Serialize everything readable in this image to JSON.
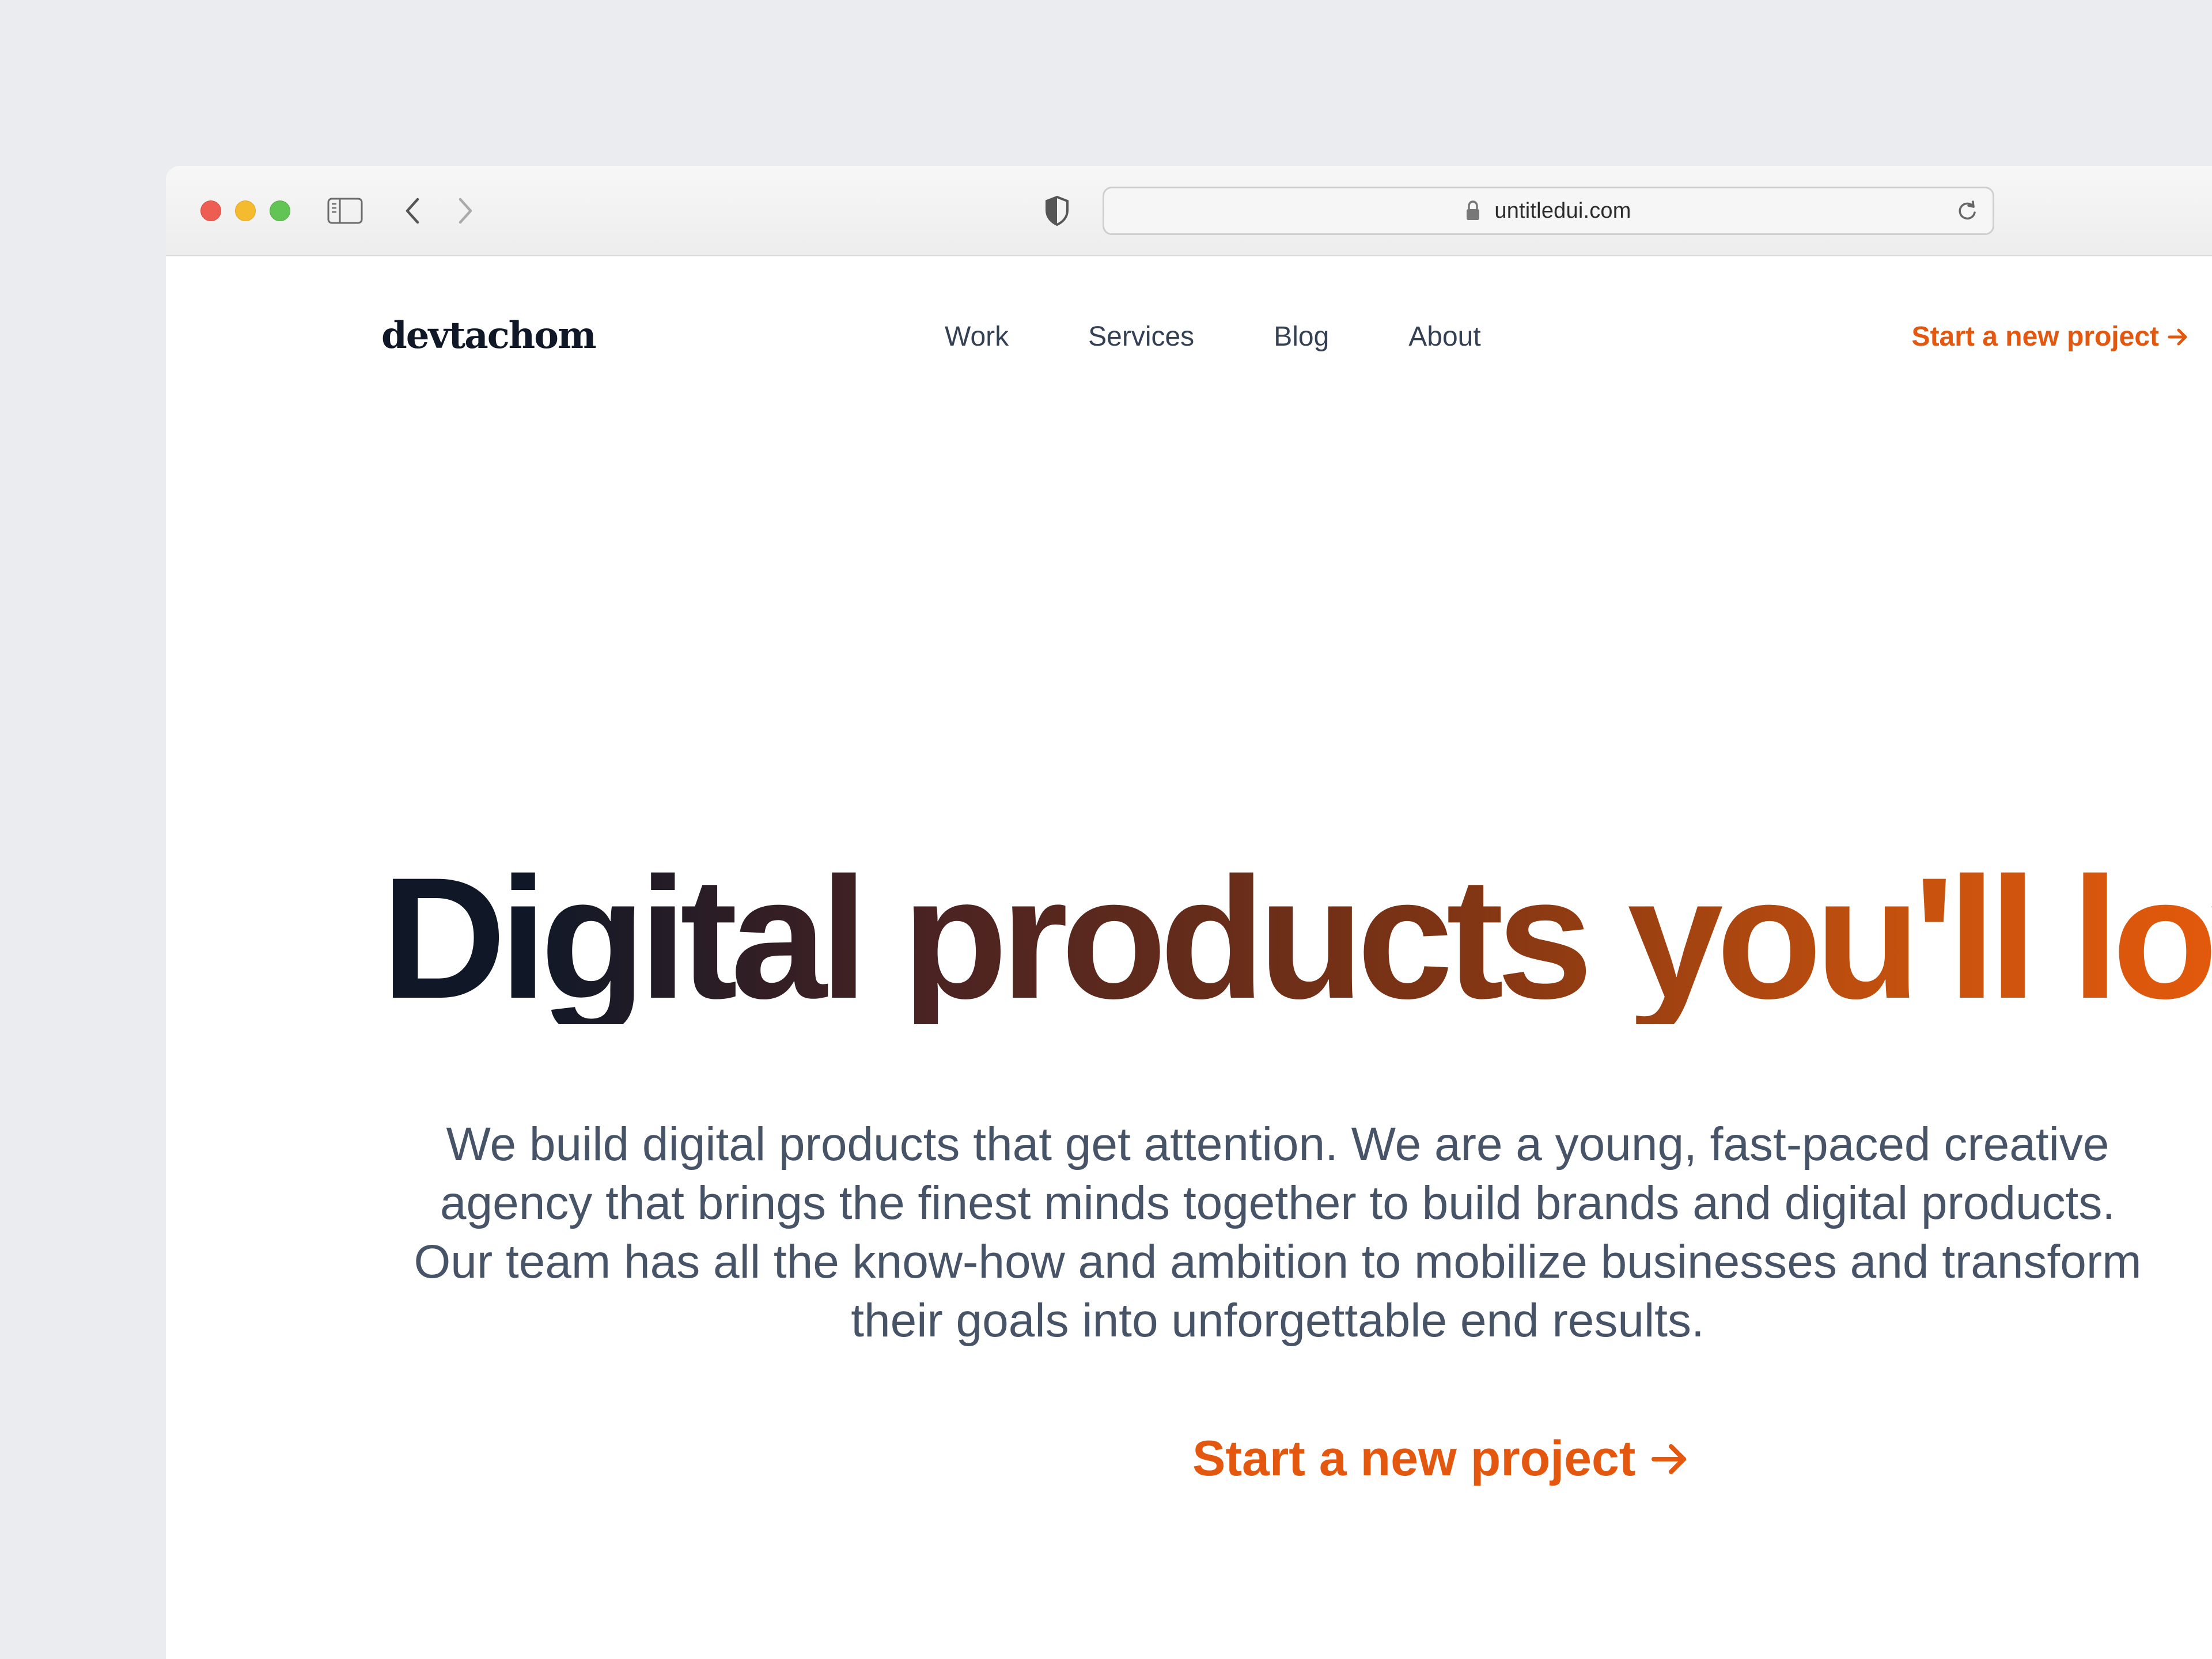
{
  "browser": {
    "url": "untitledui.com",
    "controls": {
      "close_icon": "close-dot",
      "minimize_icon": "minimize-dot",
      "zoom_icon": "zoom-dot",
      "sidebar_icon": "sidebar-toggle-icon",
      "back_icon": "chevron-left-icon",
      "forward_icon": "chevron-right-icon",
      "privacy_icon": "shield-icon",
      "lock_icon": "lock-icon",
      "reload_icon": "reload-icon"
    },
    "colors": {
      "close": "#ee5d52",
      "minimize": "#f4bb2f",
      "zoom": "#61c454"
    }
  },
  "site": {
    "logo": "devtachom",
    "nav": {
      "items": [
        {
          "label": "Work"
        },
        {
          "label": "Services"
        },
        {
          "label": "Blog"
        },
        {
          "label": "About"
        }
      ],
      "cta_label": "Start a new project",
      "cta_icon": "arrow-right-icon"
    },
    "hero": {
      "title": "Digital products you'll love",
      "body": "We build digital products that get attention. We are a young, fast-paced creative agency that brings the finest minds together to build brands and digital products. Our team has all the know-how and ambition to mobilize businesses and transform their goals into unforgettable end results.",
      "cta_label": "Start a new project",
      "cta_icon": "arrow-right-icon"
    },
    "colors": {
      "accent": "#e4570f",
      "heading_dark": "#101828",
      "body_text": "#475467",
      "nav_text": "#344054"
    }
  }
}
